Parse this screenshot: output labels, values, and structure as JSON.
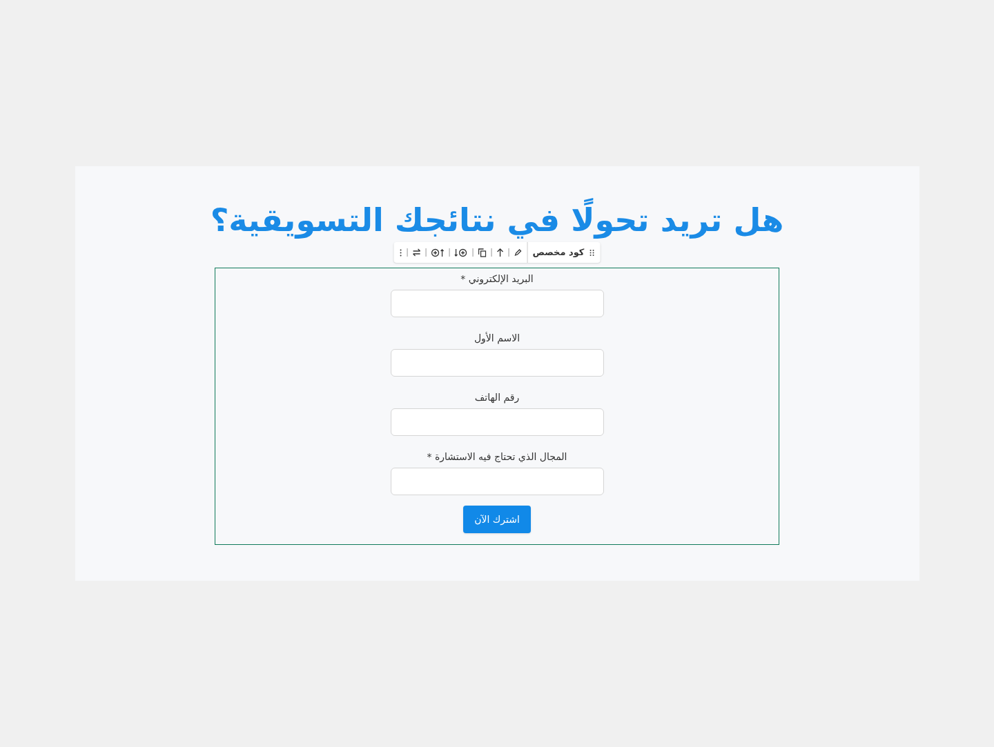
{
  "heading": "هل تريد تحولًا في نتائجك التسويقية؟",
  "toolbar": {
    "title": "كود مخصص"
  },
  "fields": [
    {
      "label": "البريد الإلكتروني *"
    },
    {
      "label": "الاسم الأول"
    },
    {
      "label": "رقم الهاتف"
    },
    {
      "label": "المجال الذي تحتاج فيه الاستشارة *"
    }
  ],
  "submit": "اشترك الآن"
}
